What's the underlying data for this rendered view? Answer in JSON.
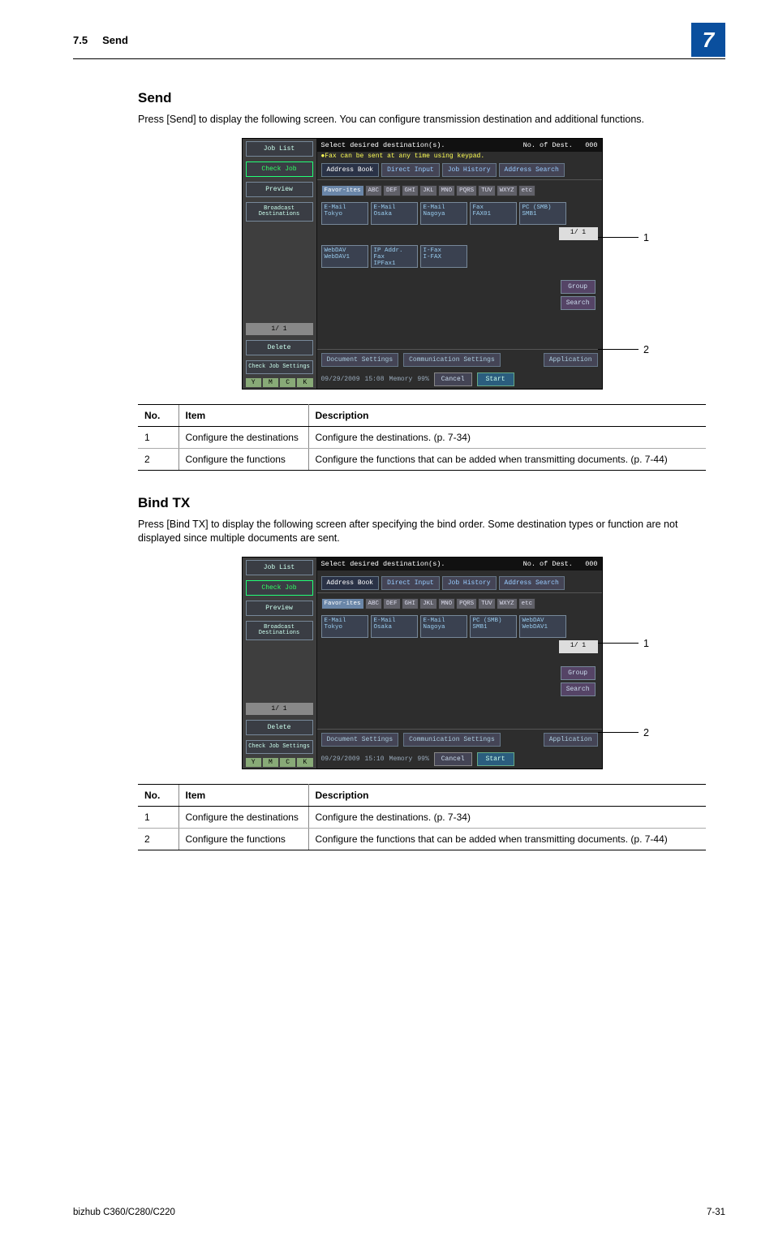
{
  "header": {
    "section_no": "7.5",
    "section_title": "Send",
    "chapter_number": "7"
  },
  "send": {
    "heading": "Send",
    "para": "Press [Send] to display the following screen. You can configure transmission destination and additional functions.",
    "callouts": {
      "c1": "1",
      "c2": "2"
    },
    "table": {
      "cols": {
        "no": "No.",
        "item": "Item",
        "desc": "Description"
      },
      "rows": [
        {
          "no": "1",
          "item": "Configure the destinations",
          "desc": "Configure the destinations. (p. 7-34)"
        },
        {
          "no": "2",
          "item": "Configure the functions",
          "desc": "Configure the functions that can be added when transmitting documents. (p. 7-44)"
        }
      ]
    }
  },
  "bindtx": {
    "heading": "Bind TX",
    "para": "Press [Bind TX] to display the following screen after specifying the bind order. Some destination types or function are not displayed since multiple documents are sent.",
    "callouts": {
      "c1": "1",
      "c2": "2"
    },
    "table": {
      "cols": {
        "no": "No.",
        "item": "Item",
        "desc": "Description"
      },
      "rows": [
        {
          "no": "1",
          "item": "Configure the destinations",
          "desc": "Configure the destinations. (p. 7-34)"
        },
        {
          "no": "2",
          "item": "Configure the functions",
          "desc": "Configure the functions that can be added when transmitting documents. (p. 7-44)"
        }
      ]
    }
  },
  "panel_send": {
    "title": "Select desired destination(s).",
    "dest_label": "No. of Dest.",
    "dest_count": "000",
    "hint": "●Fax can be sent at any time using keypad.",
    "left": {
      "job_list": "Job List",
      "check_job": "Check Job",
      "preview": "Preview",
      "bcast": "Broadcast Destinations",
      "page": "1/  1",
      "delete": "Delete",
      "check_set": "Check Job Settings",
      "ymck": [
        "Y",
        "M",
        "C",
        "K"
      ]
    },
    "tabs": {
      "address_book": "Address Book",
      "direct_input": "Direct Input",
      "job_history": "Job History",
      "addr_search": "Address Search"
    },
    "letters": [
      "Favor-ites",
      "ABC",
      "DEF",
      "GHI",
      "JKL",
      "MNO",
      "PQRS",
      "TUV",
      "WXYZ",
      "etc"
    ],
    "dests": [
      {
        "t": "E-Mail",
        "n": "Tokyo"
      },
      {
        "t": "E-Mail",
        "n": "Osaka"
      },
      {
        "t": "E-Mail",
        "n": "Nagoya"
      },
      {
        "t": "Fax",
        "n": "FAX01"
      },
      {
        "t": "PC (SMB)",
        "n": "SMB1"
      },
      {
        "t": "WebDAV",
        "n": "WebDAV1"
      },
      {
        "t": "IP Addr. Fax",
        "n": "IPFax1"
      },
      {
        "t": "I-Fax",
        "n": "I-FAX"
      }
    ],
    "dest_page": "1/  1",
    "group": "Group",
    "search": "Search",
    "footer": {
      "doc_set": "Document Settings",
      "comm_set": "Communication Settings",
      "app": "Application"
    },
    "start": {
      "cancel": "Cancel",
      "start": "Start"
    },
    "meminfo": {
      "date": "09/29/2009",
      "time": "15:08",
      "mem_label": "Memory",
      "mem_pct": "99%"
    }
  },
  "panel_bindtx": {
    "title": "Select desired destination(s).",
    "dest_label": "No. of Dest.",
    "dest_count": "000",
    "left": {
      "job_list": "Job List",
      "check_job": "Check Job",
      "preview": "Preview",
      "bcast": "Broadcast Destinations",
      "page": "1/  1",
      "delete": "Delete",
      "check_set": "Check Job Settings",
      "ymck": [
        "Y",
        "M",
        "C",
        "K"
      ]
    },
    "tabs": {
      "address_book": "Address Book",
      "direct_input": "Direct Input",
      "job_history": "Job History",
      "addr_search": "Address Search"
    },
    "letters": [
      "Favor-ites",
      "ABC",
      "DEF",
      "GHI",
      "JKL",
      "MNO",
      "PQRS",
      "TUV",
      "WXYZ",
      "etc"
    ],
    "dests": [
      {
        "t": "E-Mail",
        "n": "Tokyo"
      },
      {
        "t": "E-Mail",
        "n": "Osaka"
      },
      {
        "t": "E-Mail",
        "n": "Nagoya"
      },
      {
        "t": "PC (SMB)",
        "n": "SMB1"
      },
      {
        "t": "WebDAV",
        "n": "WebDAV1"
      }
    ],
    "dest_page": "1/  1",
    "group": "Group",
    "search": "Search",
    "footer": {
      "doc_set": "Document Settings",
      "comm_set": "Communication Settings",
      "app": "Application"
    },
    "start": {
      "cancel": "Cancel",
      "start": "Start"
    },
    "meminfo": {
      "date": "09/29/2009",
      "time": "15:10",
      "mem_label": "Memory",
      "mem_pct": "99%"
    }
  },
  "page_footer": {
    "model": "bizhub C360/C280/C220",
    "pageno": "7-31"
  }
}
